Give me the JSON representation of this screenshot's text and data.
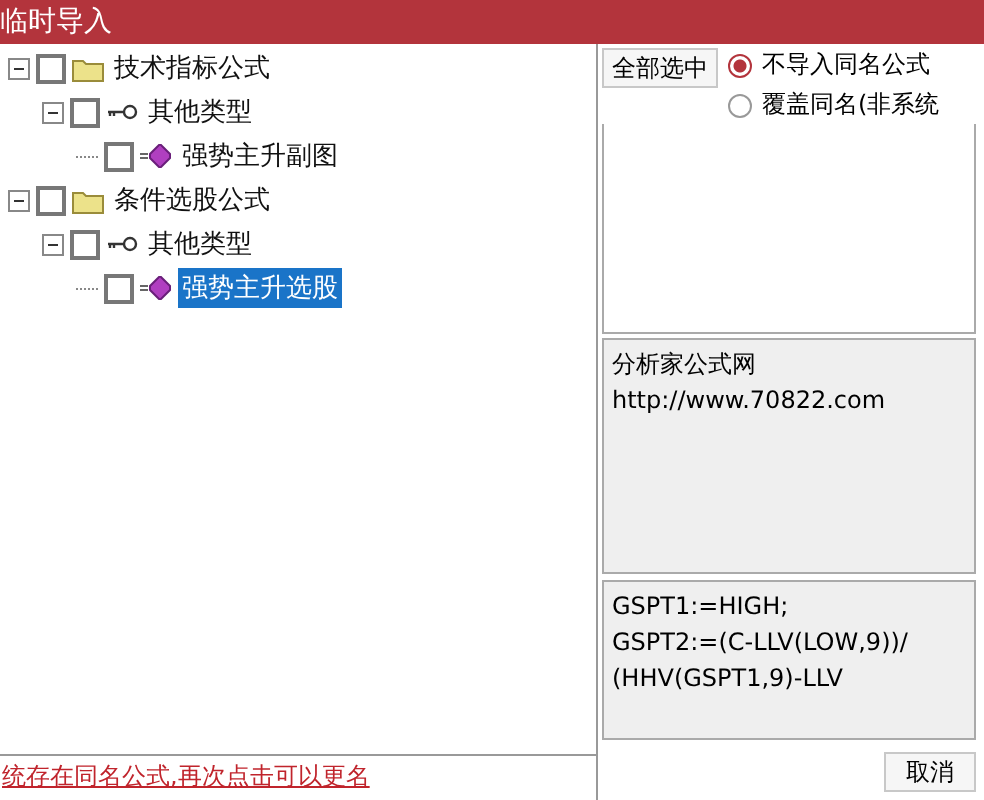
{
  "window": {
    "title": "临时导入"
  },
  "tree": [
    {
      "label": "技术指标公式",
      "kind": "folder",
      "checked": false,
      "expanded": true,
      "selected": false,
      "children": [
        {
          "label": "其他类型",
          "kind": "type",
          "checked": false,
          "expanded": true,
          "selected": false,
          "children": [
            {
              "label": "强势主升副图",
              "kind": "formula",
              "checked": false,
              "selected": false
            }
          ]
        }
      ]
    },
    {
      "label": "条件选股公式",
      "kind": "folder",
      "checked": false,
      "expanded": true,
      "selected": false,
      "children": [
        {
          "label": "其他类型",
          "kind": "type",
          "checked": false,
          "expanded": true,
          "selected": false,
          "children": [
            {
              "label": "强势主升选股",
              "kind": "formula",
              "checked": false,
              "selected": true
            }
          ]
        }
      ]
    }
  ],
  "select_all_button": "全部选中",
  "options": [
    {
      "label": "不导入同名公式",
      "selected": true
    },
    {
      "label": "覆盖同名(非系统",
      "selected": false
    }
  ],
  "info": [
    "分析家公式网",
    "http://www.70822.com"
  ],
  "formula": [
    "GSPT1:=HIGH;",
    "GSPT2:=(C-LLV(LOW,9))/",
    "(HHV(GSPT1,9)-LLV"
  ],
  "status": "统存在同名公式,再次点击可以更名",
  "cancel_button": "取消"
}
